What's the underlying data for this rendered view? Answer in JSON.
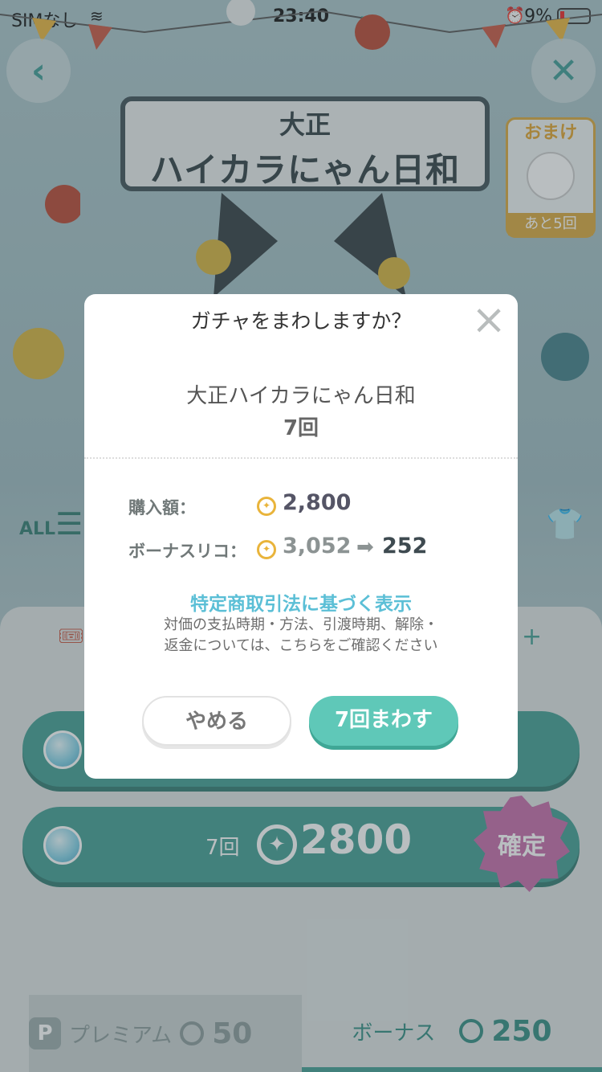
{
  "status_bar": {
    "carrier": "SIMなし",
    "time": "23:40",
    "battery": "9%"
  },
  "background": {
    "title_small": "大正",
    "title_large": "ハイカラにゃん日和",
    "omake_label": "おまけ",
    "omake_remaining": "あと5回",
    "all_label": "ALL",
    "plus_label": "+",
    "gacha_rows": [
      {
        "count": "",
        "price": ""
      },
      {
        "count": "7回",
        "price": "2800"
      }
    ],
    "kakutei_label": "確定",
    "tabs": {
      "premium_label": "プレミアム",
      "premium_amount": "50",
      "bonus_label": "ボーナス",
      "bonus_amount": "250"
    }
  },
  "dialog": {
    "title": "ガチャをまわしますか？",
    "gacha_name": "大正ハイカラにゃん日和",
    "spin_count": "7回",
    "purchase_label": "購入額：",
    "purchase_amount": "2,800",
    "bonus_label": "ボーナスリコ：",
    "bonus_before": "3,052",
    "bonus_after": "252",
    "law_link": "特定商取引法に基づく表示",
    "law_note_line1": "対価の支払時期・方法、引渡時期、解除・",
    "law_note_line2": "返金については、こちらをご確認ください",
    "cancel_label": "やめる",
    "confirm_label": "7回まわす"
  },
  "colors": {
    "accent": "#5fc8b8",
    "link": "#5bbfd6",
    "coin": "#e9b43b"
  }
}
